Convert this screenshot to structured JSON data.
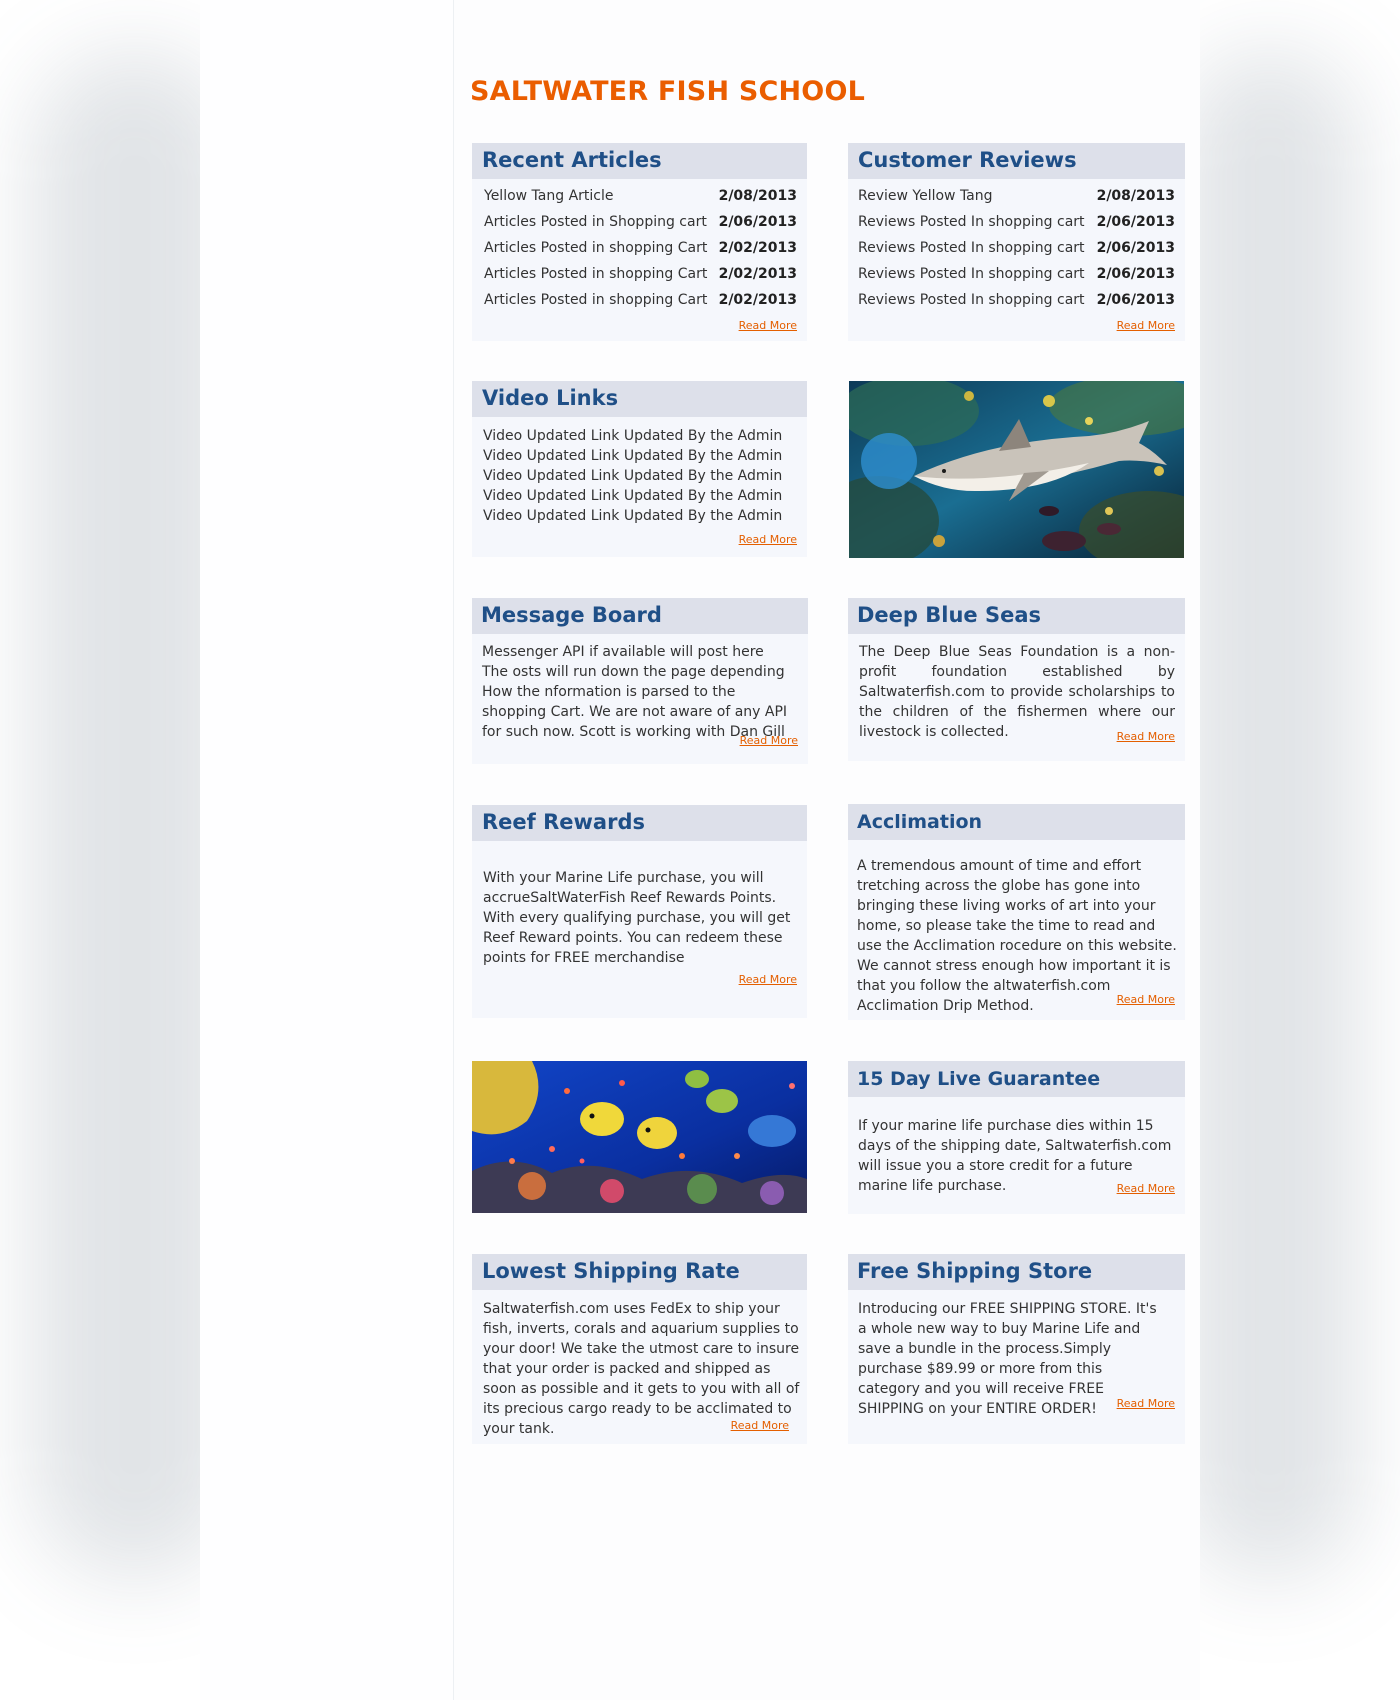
{
  "site_title": "SALTWATER FISH SCHOOL",
  "colors": {
    "accent_orange": "#ea5d00",
    "heading_blue": "#1f4f87",
    "card_header_bg": "#dde0ea",
    "card_body_bg": "#f5f7fc"
  },
  "read_more_label": "Read More",
  "recent_articles": {
    "title": "Recent Articles",
    "items": [
      {
        "label": "Yellow Tang Article",
        "date": "2/08/2013"
      },
      {
        "label": "Articles Posted in Shopping cart",
        "date": "2/06/2013"
      },
      {
        "label": "Articles Posted in shopping Cart",
        "date": "2/02/2013"
      },
      {
        "label": "Articles Posted in shopping Cart",
        "date": "2/02/2013"
      },
      {
        "label": "Articles Posted in shopping Cart",
        "date": "2/02/2013"
      }
    ]
  },
  "customer_reviews": {
    "title": "Customer Reviews",
    "items": [
      {
        "label": "Review Yellow Tang",
        "date": "2/08/2013"
      },
      {
        "label": "Reviews Posted In shopping cart",
        "date": "2/06/2013"
      },
      {
        "label": "Reviews Posted In shopping cart",
        "date": "2/06/2013"
      },
      {
        "label": "Reviews Posted In shopping cart",
        "date": "2/06/2013"
      },
      {
        "label": "Reviews Posted In shopping cart",
        "date": "2/06/2013"
      }
    ]
  },
  "video_links": {
    "title": "Video Links",
    "items": [
      "Video Updated Link Updated By the Admin",
      "Video Updated Link Updated By the Admin",
      "Video Updated Link Updated By the Admin",
      "Video Updated Link Updated By the Admin",
      "Video Updated Link Updated By the Admin"
    ]
  },
  "message_board": {
    "title": "Message Board",
    "text": "Messenger API  if available will post here The osts will run down the page depending  How the nformation is parsed to the shopping Cart. We are not aware of any API for such now. Scott is working with Dan Gill"
  },
  "deep_blue_seas": {
    "title": "Deep Blue Seas",
    "text": "The Deep Blue Seas Foundation is a non-profit foundation established by Saltwaterfish.com to provide scholarships to the children of the fishermen where our livestock is collected."
  },
  "reef_rewards": {
    "title": "Reef Rewards",
    "text": "With your Marine Life purchase, you will accrueSaltWaterFish Reef Rewards Points. With every qualifying purchase, you will get Reef Reward points. You can redeem these points for FREE merchandise"
  },
  "acclimation": {
    "title": "Acclimation",
    "text": "A tremendous amount of time and effort tretching across the globe has gone into bringing these living works of art into your home, so please take the time to read and use the Acclimation rocedure on this website. We cannot stress enough how important it is that you follow the altwaterfish.com Acclimation Drip Method."
  },
  "live_guarantee": {
    "title": "15 Day Live Guarantee",
    "text": "If your marine life purchase dies within 15 days of the shipping date, Saltwaterfish.com will issue you a store credit for a future marine life purchase."
  },
  "lowest_shipping": {
    "title": "Lowest Shipping Rate",
    "text": "Saltwaterfish.com uses FedEx to ship your fish, inverts, corals and aquarium supplies to your door! We take the utmost care to insure that your order is packed and shipped as soon as possible and it gets to you with all of its precious cargo ready to be acclimated to your tank."
  },
  "free_shipping": {
    "title": "Free Shipping Store",
    "text": "Introducing our FREE SHIPPING STORE.  It's a whole new way to buy Marine Life and save a bundle in the process.Simply purchase $89.99 or more from this category and you will receive FREE SHIPPING on your ENTIRE ORDER!"
  }
}
